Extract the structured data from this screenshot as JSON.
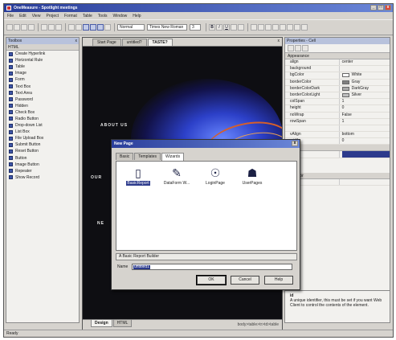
{
  "window": {
    "title": "OneMeasure - Spotlight meetings",
    "buttons": [
      "_",
      "□",
      "x"
    ]
  },
  "menu": [
    "File",
    "Edit",
    "View",
    "Project",
    "Format",
    "Table",
    "Tools",
    "Window",
    "Help"
  ],
  "toolbar": {
    "style_select": "Normal",
    "font_select": "Times New Roman",
    "size_select": "3",
    "format_buttons": [
      "B",
      "I",
      "U"
    ]
  },
  "toolbox": {
    "title": "Toolbox",
    "close": "x",
    "category": "HTML",
    "items": [
      "Create Hyperlink",
      "Horizontal Rule",
      "Table",
      "Image",
      "Form",
      "Text Box",
      "Text Area",
      "Password",
      "Hidden",
      "Check Box",
      "Radio Button",
      "Drop-down List",
      "List Box",
      "File Upload Box",
      "Submit Button",
      "Reset Button",
      "Button",
      "Image Button",
      "Repeater",
      "Show Record"
    ]
  },
  "document": {
    "tabs": [
      "Start Page",
      "untitled?",
      "TASTE?"
    ],
    "close": "x",
    "canvas_text": [
      "ABOUT US",
      "OUR",
      "NE"
    ],
    "view_tabs": [
      "Design",
      "HTML"
    ],
    "status": "body>table>tr>td>table"
  },
  "properties": {
    "title": "Properties - Cell",
    "category": "Appearance",
    "rows": [
      {
        "name": "align",
        "value": "center"
      },
      {
        "name": "background",
        "value": ""
      },
      {
        "name": "bgColor",
        "value": "White",
        "color": "#ffffff"
      },
      {
        "name": "borderColor",
        "value": "Gray",
        "color": "#808080"
      },
      {
        "name": "borderColorDark",
        "value": "DarkGray",
        "color": "#a9a9a9"
      },
      {
        "name": "borderColorLight",
        "value": "Silver",
        "color": "#c0c0c0"
      },
      {
        "name": "colSpan",
        "value": "1"
      },
      {
        "name": "height",
        "value": "0"
      },
      {
        "name": "noWrap",
        "value": "False"
      },
      {
        "name": "rowSpan",
        "value": "1"
      },
      {
        "name": "",
        "value": ""
      },
      {
        "name": "vAlign",
        "value": "bottom"
      },
      {
        "name": "width",
        "value": "0"
      }
    ],
    "category2": "Misc",
    "rows2": [
      {
        "name": "name",
        "value": ""
      }
    ],
    "category3": "Behavior",
    "rows3": [
      {
        "name": "runat",
        "value": ""
      }
    ],
    "description_title": "id",
    "description": "A unique identifier, this must be set if you want Web Client to control the contents of the element."
  },
  "dialog": {
    "title": "New Page",
    "close": "x",
    "tabs": [
      "Basic",
      "Templates",
      "Wizards"
    ],
    "active_tab": "Wizards",
    "items": [
      {
        "icon": "report-builder-icon",
        "label": "BasicReport"
      },
      {
        "icon": "data-form-icon",
        "label": "DataForm W..."
      },
      {
        "icon": "login-page-icon",
        "label": "LoginPage"
      },
      {
        "icon": "user-pages-icon",
        "label": "UserPages"
      }
    ],
    "description": "A Basic Report Builder",
    "name_label": "Name",
    "name_value": "untitled1",
    "buttons": {
      "ok": "OK",
      "cancel": "Cancel",
      "help": "Help"
    }
  },
  "status": "Ready"
}
